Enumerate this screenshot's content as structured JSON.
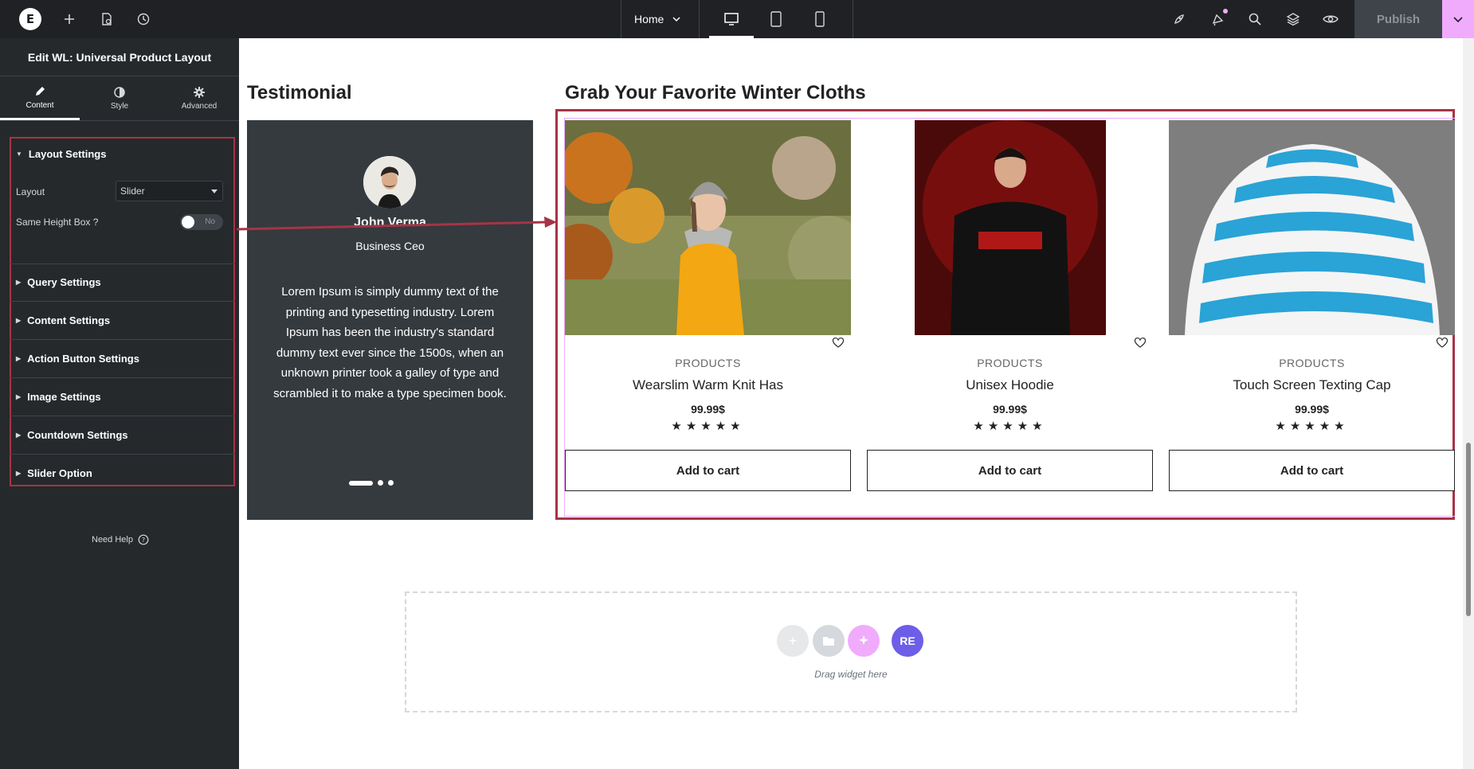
{
  "topbar": {
    "logo": "E",
    "home_label": "Home",
    "publish_label": "Publish"
  },
  "panel": {
    "title": "Edit WL: Universal Product Layout",
    "tabs": [
      {
        "label": "Content",
        "icon": "pencil-icon"
      },
      {
        "label": "Style",
        "icon": "contrast-icon"
      },
      {
        "label": "Advanced",
        "icon": "gear-icon"
      }
    ],
    "layout_settings": {
      "heading": "Layout Settings",
      "layout_label": "Layout",
      "layout_value": "Slider",
      "same_height_label": "Same Height Box ?",
      "same_height_value": "No"
    },
    "sections": [
      "Query Settings",
      "Content Settings",
      "Action Button Settings",
      "Image Settings",
      "Countdown Settings",
      "Slider Option"
    ],
    "need_help": "Need Help"
  },
  "testimonial": {
    "heading": "Testimonial",
    "name": "John Verma",
    "role": "Business Ceo",
    "text": "Lorem Ipsum is simply dummy text of the printing and typesetting industry. Lorem Ipsum has been the industry's standard dummy text ever since the 1500s, when an unknown printer took a galley of type and scrambled it to make a type specimen book."
  },
  "products": {
    "heading": "Grab Your Favorite Winter Cloths",
    "items": [
      {
        "category": "PRODUCTS",
        "name": "Wearslim Warm Knit Has",
        "price": "99.99$",
        "stars": "★★★★★",
        "button": "Add to cart"
      },
      {
        "category": "PRODUCTS",
        "name": "Unisex Hoodie",
        "price": "99.99$",
        "stars": "★★★★★",
        "button": "Add to cart"
      },
      {
        "category": "PRODUCTS",
        "name": "Touch Screen Texting Cap",
        "price": "99.99$",
        "stars": "★★★★★",
        "button": "Add to cart"
      }
    ]
  },
  "drop_zone": {
    "text": "Drag widget here",
    "badge": "RE"
  },
  "colors": {
    "accent_pink": "#f0abfc",
    "highlight_red": "#a63446",
    "panel_bg": "#26292c"
  }
}
